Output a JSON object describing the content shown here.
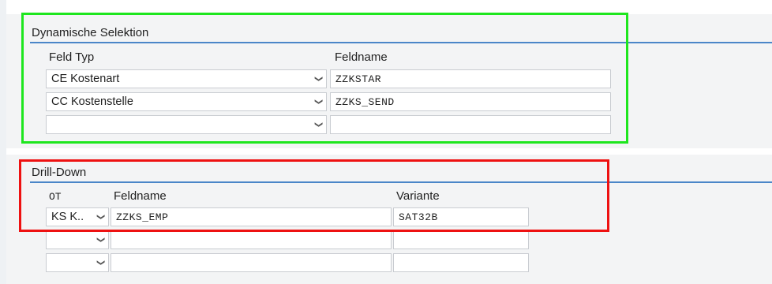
{
  "dynamic_selection": {
    "title": "Dynamische Selektion",
    "col_field_type": "Feld Typ",
    "col_field_name": "Feldname",
    "rows": [
      {
        "type": "CE Kostenart",
        "name": "ZZKSTAR"
      },
      {
        "type": "CC Kostenstelle",
        "name": "ZZKS_SEND"
      },
      {
        "type": "",
        "name": ""
      }
    ]
  },
  "drill_down": {
    "title": "Drill-Down",
    "col_ot": "OT",
    "col_field_name": "Feldname",
    "col_variant": "Variante",
    "rows": [
      {
        "ot": "KS K..",
        "name": "ZZKS_EMP",
        "variant": "SAT32B"
      },
      {
        "ot": "",
        "name": "",
        "variant": ""
      },
      {
        "ot": "",
        "name": "",
        "variant": ""
      }
    ]
  },
  "icons": {
    "dropdown": "chevron-down-icon"
  },
  "colors": {
    "highlight_green": "#1ee61e",
    "highlight_red": "#ee1111",
    "group_line": "#4a86c8"
  }
}
